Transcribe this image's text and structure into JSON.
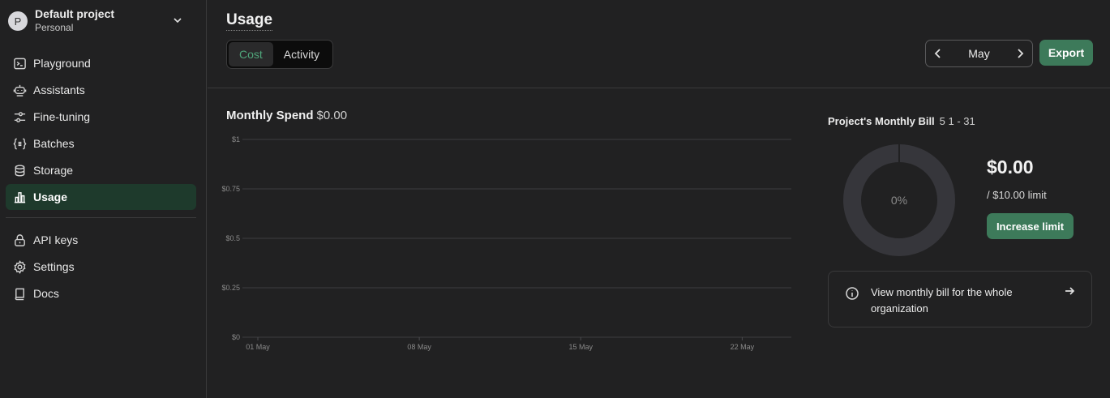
{
  "project": {
    "avatar_letter": "P",
    "name": "Default project",
    "subtitle": "Personal"
  },
  "sidebar": {
    "items": [
      {
        "label": "Playground",
        "icon": "terminal-icon"
      },
      {
        "label": "Assistants",
        "icon": "robot-icon"
      },
      {
        "label": "Fine-tuning",
        "icon": "sliders-icon"
      },
      {
        "label": "Batches",
        "icon": "braces-icon"
      },
      {
        "label": "Storage",
        "icon": "database-icon"
      },
      {
        "label": "Usage",
        "icon": "bar-chart-icon",
        "active": true
      }
    ],
    "bottom_items": [
      {
        "label": "API keys",
        "icon": "lock-icon"
      },
      {
        "label": "Settings",
        "icon": "gear-icon"
      },
      {
        "label": "Docs",
        "icon": "book-icon"
      }
    ]
  },
  "header": {
    "title": "Usage",
    "tabs": [
      {
        "label": "Cost",
        "active": true
      },
      {
        "label": "Activity"
      }
    ],
    "month": "May",
    "export_label": "Export"
  },
  "spend": {
    "title": "Monthly Spend",
    "value": "$0.00"
  },
  "chart_data": {
    "type": "bar",
    "title": "Monthly Spend",
    "y_tick_labels": [
      "$0",
      "$0.25",
      "$0.5",
      "$0.75",
      "$1"
    ],
    "y_ticks": [
      0,
      0.25,
      0.5,
      0.75,
      1
    ],
    "ylim": [
      0,
      1
    ],
    "x_tick_labels": [
      "01 May",
      "08 May",
      "15 May",
      "22 May"
    ],
    "categories": [
      "01 May",
      "08 May",
      "15 May",
      "22 May"
    ],
    "values": [
      0,
      0,
      0,
      0
    ],
    "grid": true
  },
  "bill": {
    "title": "Project's Monthly Bill",
    "range": "5 1 - 31",
    "percent_label": "0%",
    "percent": 0,
    "amount": "$0.00",
    "limit": "/ $10.00 limit",
    "increase_label": "Increase limit",
    "org_link": "View monthly bill for the whole organization"
  },
  "colors": {
    "accent": "#3d7a5a",
    "active_tab_text": "#4fa57a",
    "active_nav_bg": "#1e3a2c",
    "donut_track": "#36363b"
  }
}
